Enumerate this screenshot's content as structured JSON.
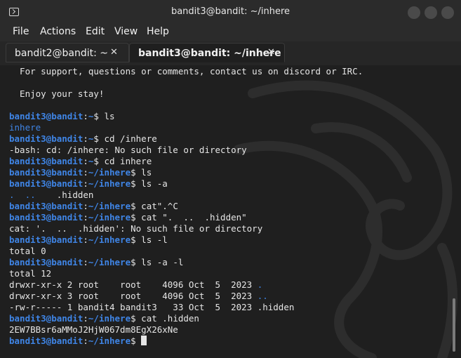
{
  "window": {
    "title": "bandit3@bandit: ~/inhere"
  },
  "menu": [
    "File",
    "Actions",
    "Edit",
    "View",
    "Help"
  ],
  "tabs": [
    {
      "label": "bandit2@bandit: ~",
      "close": "✕"
    },
    {
      "label": "bandit3@bandit: ~/inhere",
      "close": "✕"
    }
  ],
  "terminal": {
    "motd": [
      "  For support, questions or comments, contact us on discord or IRC.",
      "",
      "  Enjoy your stay!",
      ""
    ],
    "user_host": "bandit3@bandit",
    "sessions": [
      {
        "path": "~",
        "cmd": "ls",
        "output": [
          {
            "text": "inhere",
            "cls": "d"
          }
        ]
      },
      {
        "path": "~",
        "cmd": "cd /inhere",
        "output": [
          {
            "text": "-bash: cd: /inhere: No such file or directory",
            "cls": "w"
          }
        ]
      },
      {
        "path": "~",
        "cmd": "cd inhere",
        "output": []
      },
      {
        "path": "~/inhere",
        "cmd": "ls",
        "output": []
      },
      {
        "path": "~/inhere",
        "cmd": "ls -a",
        "output": [
          {
            "text": ".  ..  ",
            "cls": "d",
            "extra": "  .hidden"
          }
        ]
      },
      {
        "path": "~/inhere",
        "cmd": "cat\".^C",
        "output": []
      },
      {
        "path": "~/inhere",
        "cmd": "cat \".  ..  .hidden\"",
        "output": [
          {
            "text": "cat: '.  ..  .hidden': No such file or directory",
            "cls": "w"
          }
        ]
      },
      {
        "path": "~/inhere",
        "cmd": "ls -l",
        "output": [
          {
            "text": "total 0",
            "cls": "w"
          }
        ]
      },
      {
        "path": "~/inhere",
        "cmd": "ls -a -l",
        "output": [
          {
            "text": "total 12",
            "cls": "w"
          },
          {
            "text": "drwxr-xr-x 2 root    root    4096 Oct  5  2023 ",
            "cls": "w",
            "tail": "."
          },
          {
            "text": "drwxr-xr-x 3 root    root    4096 Oct  5  2023 ",
            "cls": "w",
            "tail": ".."
          },
          {
            "text": "-rw-r----- 1 bandit4 bandit3   33 Oct  5  2023 .hidden",
            "cls": "w"
          }
        ]
      },
      {
        "path": "~/inhere",
        "cmd": "cat .hidden",
        "output": [
          {
            "text": "2EW7BBsr6aMMoJ2HjW067dm8EgX26xNe",
            "cls": "w"
          }
        ]
      },
      {
        "path": "~/inhere",
        "cmd": "",
        "output": [],
        "cursor": true
      }
    ]
  }
}
